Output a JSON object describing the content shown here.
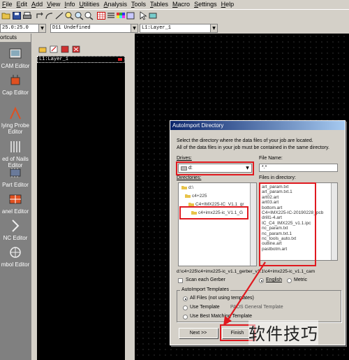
{
  "menu": [
    "File",
    "Edit",
    "Add",
    "View",
    "Info",
    "Utilities",
    "Analysis",
    "Tools",
    "Tables",
    "Macro",
    "Settings",
    "Help"
  ],
  "toolbar_icons": [
    "open-icon",
    "save-icon",
    "print-icon",
    "undo-icon",
    "redo-icon",
    "route-icon",
    "zoom-in-icon",
    "zoom-out-icon",
    "grid-icon",
    "palette-icon",
    "layers-icon",
    "settings-icon",
    "cursor-icon",
    "highlight-icon"
  ],
  "combos": {
    "grid": "25.0:25.0",
    "dcode": "D11   Undefined",
    "layer": "L1:Layer_1"
  },
  "shortcuts": {
    "title": "ortcuts",
    "items": [
      "CAM Editor",
      "Cap Editor",
      "lying Probe\nEditor",
      "ed of Nails\nEditor",
      "Part Editor",
      "anel Editor",
      "NC Editor",
      "mbol Editor"
    ]
  },
  "layers": {
    "items": [
      "L1:Layer_1"
    ]
  },
  "dialog": {
    "title": "AutoImport Directory",
    "instructions_1": "Select the directory where the data files of your job are located.",
    "instructions_2": "All of the data files in your job must be contained in the same directory.",
    "drives_label": "Drives:",
    "drive_value": "d:",
    "file_name_label": "File Name:",
    "file_name_value": "*.*",
    "directories_label": "Directories:",
    "directories": [
      "d:\\",
      "c4+225",
      "C4+IMX225-IC_V1.1_gr",
      "c4+imx225-ic_V1.1_G"
    ],
    "files_label": "Files in directory:",
    "files": [
      "art_param.txt",
      "art_param.txt.1",
      "art02.art",
      "art03.art",
      "bottom.art",
      "C4+IMX225-IC-20190228_pcb",
      "drill1-4.art",
      "IC_C4_IMX225_v1.1.ipc",
      "nc_param.txt",
      "nc_param.txt.1",
      "nc_tools_auto.txt",
      "outline.art",
      "pastbotm.art"
    ],
    "path": "d:\\c4+225\\c4+imx225-ic_v1.1_gerber_v1.1\\c4+imx225-ic_v1.1_cam",
    "scan_each_gerber": "Scan each Gerber",
    "english": "English",
    "metric": "Metric",
    "templates_label": "AutoImport Templates",
    "template_all": "All Files (not using templates)",
    "template_use": "Use Template",
    "template_use_value": "PADS General Template",
    "template_best": "Use Best Matching Template",
    "next_button": "Next >>",
    "finish_button": "Finish"
  },
  "watermark": "软件技巧",
  "colors": {
    "highlight": "#e0191f",
    "title_active": "#0a246a"
  }
}
